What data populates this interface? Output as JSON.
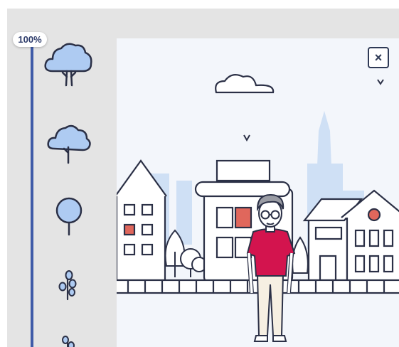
{
  "progress": {
    "label": "100%",
    "value": 1.0
  },
  "tree_options": [
    {
      "icon": "large-tree-icon"
    },
    {
      "icon": "medium-tree-icon"
    },
    {
      "icon": "small-tree-icon"
    },
    {
      "icon": "sapling-icon"
    },
    {
      "icon": "sprout-icon"
    }
  ],
  "scene": {
    "close_label": "×",
    "colors": {
      "outline": "#2b3046",
      "tree_fill": "#aecbf2",
      "skyline": "#cfe0f5",
      "shirt": "#d3144e",
      "window_accent": "#e0675c",
      "background": "#f3f6fb"
    }
  }
}
